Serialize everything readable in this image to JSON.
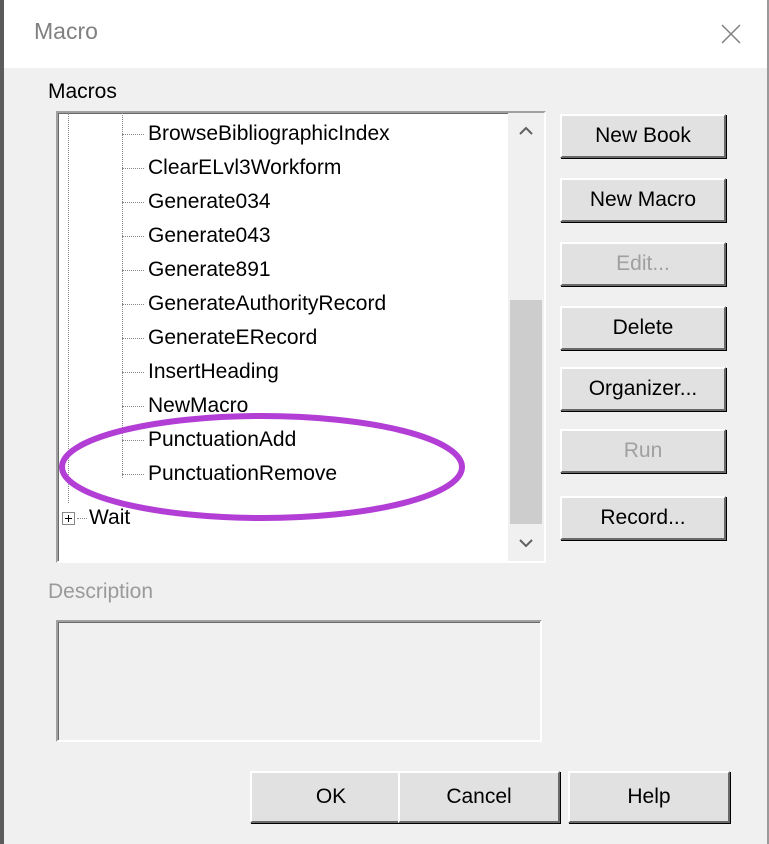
{
  "window": {
    "title": "Macro",
    "close_icon": "close-icon"
  },
  "labels": {
    "macros": "Macros",
    "description": "Description"
  },
  "tree": {
    "items": [
      {
        "label": "BrowseBibliographicIndex"
      },
      {
        "label": "ClearELvl3Workform"
      },
      {
        "label": "Generate034"
      },
      {
        "label": "Generate043"
      },
      {
        "label": "Generate891"
      },
      {
        "label": "GenerateAuthorityRecord"
      },
      {
        "label": "GenerateERecord"
      },
      {
        "label": "InsertHeading"
      },
      {
        "label": "NewMacro"
      },
      {
        "label": "PunctuationAdd"
      },
      {
        "label": "PunctuationRemove"
      }
    ],
    "collapsed_node": "Wait"
  },
  "side_buttons": {
    "new_book": "New Book",
    "new_macro": "New Macro",
    "edit": "Edit...",
    "delete": "Delete",
    "organizer": "Organizer...",
    "run": "Run",
    "record": "Record..."
  },
  "bottom_buttons": {
    "ok": "OK",
    "cancel": "Cancel",
    "help": "Help"
  },
  "annotation": {
    "color": "#b23ed6"
  }
}
